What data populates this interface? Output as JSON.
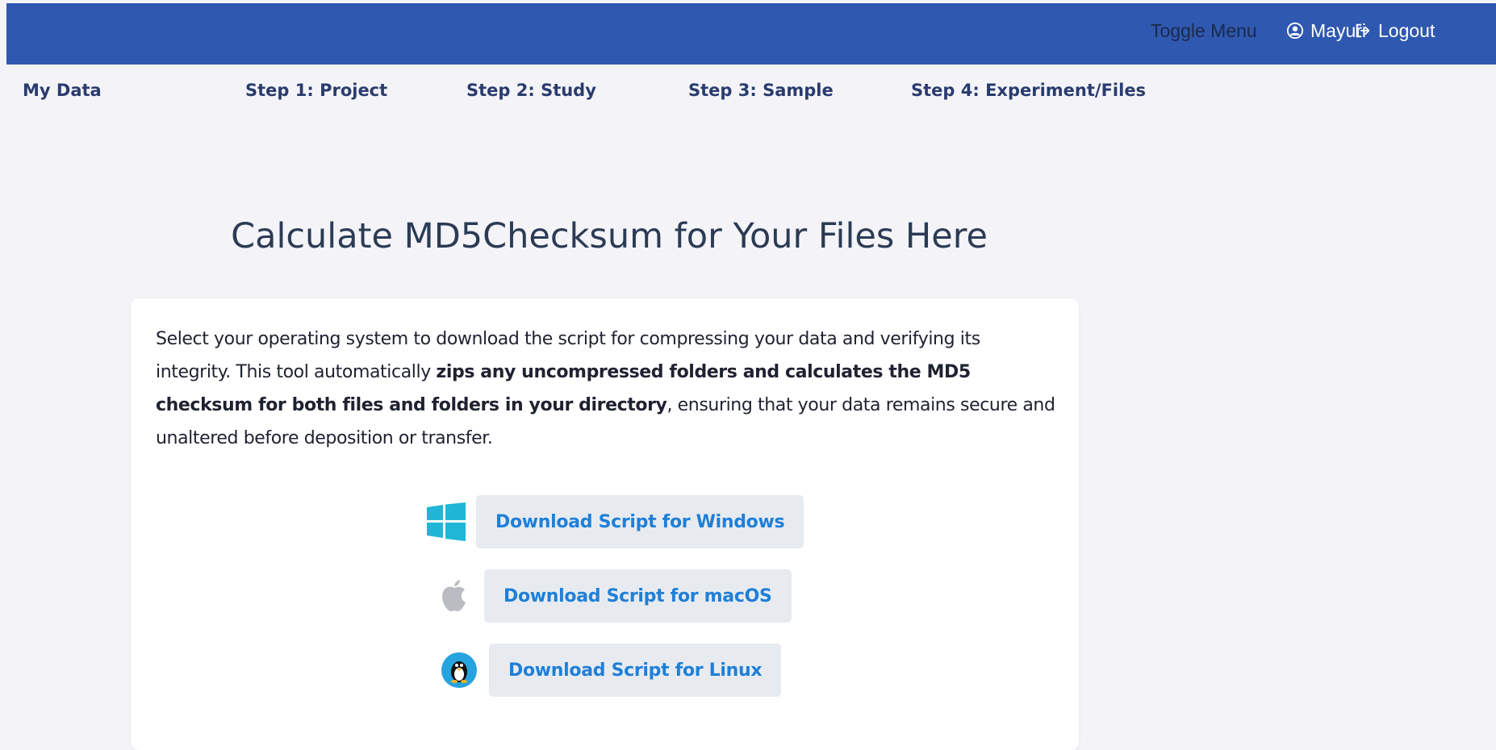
{
  "topbar": {
    "toggle_menu": "Toggle Menu",
    "user_name": "Mayuri",
    "logout": "Logout",
    "color": "#2f58b0"
  },
  "steps": {
    "my_data": "My Data",
    "project": "Step 1: Project",
    "study": "Step 2: Study",
    "sample": "Step 3: Sample",
    "experiment": "Step 4: Experiment/Files"
  },
  "main": {
    "title": "Calculate MD5Checksum for Your Files Here",
    "description": {
      "part1": "Select your operating system to download the script for compressing your data and verifying its integrity. This tool automatically ",
      "bold": "zips any uncompressed folders and calculates the MD5 checksum for both files and folders in your directory",
      "part2": ", ensuring that your data remains secure and unaltered before deposition or transfer."
    },
    "downloads": {
      "windows": {
        "label": "Download Script for Windows",
        "icon": "windows-logo-icon"
      },
      "macos": {
        "label": "Download Script for macOS",
        "icon": "apple-logo-icon"
      },
      "linux": {
        "label": "Download Script for Linux",
        "icon": "linux-tux-icon"
      }
    }
  },
  "colors": {
    "link_blue": "#1f7fd8",
    "button_bg": "#e7ebf0",
    "page_bg": "#f4f4f8"
  }
}
